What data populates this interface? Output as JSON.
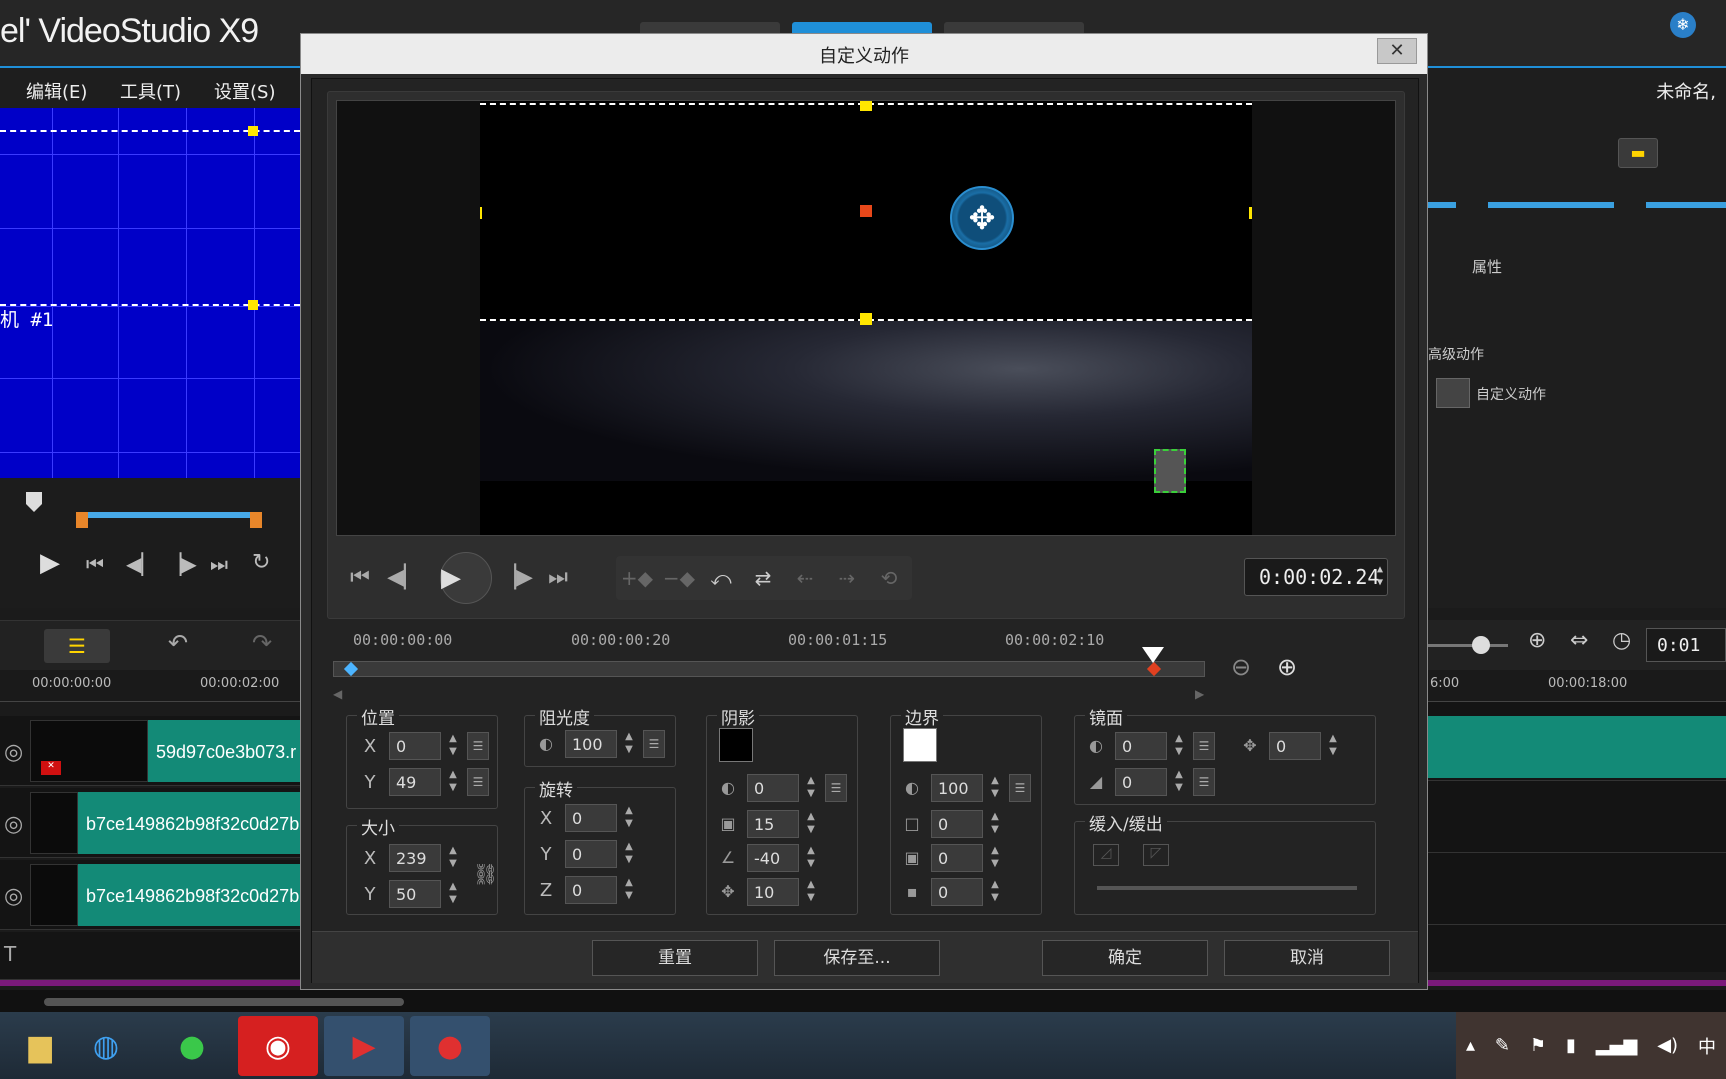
{
  "app": {
    "brand": "el' VideoStudio X9",
    "menu": [
      "编辑(E)",
      "工具(T)",
      "设置(S)"
    ],
    "project_name": "未命名, ",
    "track_label": "机 #1",
    "ruler_left": [
      "00:00:00:00",
      "00:00:02:00"
    ],
    "ruler_right": [
      "6:00",
      "00:00:18:00"
    ],
    "right_timecode": "0:01",
    "right_panel": {
      "section": "属性",
      "advanced": "高级动作",
      "custom": "自定义动作"
    },
    "clips": [
      {
        "label": "59d97c0e3b073.r"
      },
      {
        "label": "b7ce149862b98f32c0d27b"
      },
      {
        "label": "b7ce149862b98f32c0d27b"
      }
    ]
  },
  "dialog": {
    "title": "自定义动作",
    "close_label": "✕",
    "timecode": "0:00:02.24",
    "timeline_labels": [
      "00:00:00:00",
      "00:00:00:20",
      "00:00:01:15",
      "00:00:02:10"
    ],
    "playhead_fraction": 0.943,
    "groups": {
      "position": {
        "title": "位置",
        "x": "0",
        "y": "49"
      },
      "size": {
        "title": "大小",
        "x": "239",
        "y": "50"
      },
      "opacity": {
        "title": "阻光度",
        "value": "100"
      },
      "rotation": {
        "title": "旋转",
        "x": "0",
        "y": "0",
        "z": "0"
      },
      "shadow": {
        "title": "阴影",
        "color": "#000000",
        "opacity": "0",
        "blur": "15",
        "angle": "-40",
        "distance": "10"
      },
      "border": {
        "title": "边界",
        "color": "#ffffff",
        "opacity": "100",
        "width": "0",
        "blur": "0",
        "inner": "0"
      },
      "mirror": {
        "title": "镜面",
        "opacity": "0",
        "distance": "0",
        "fade": "0"
      },
      "ease": {
        "title": "缓入/缓出"
      }
    },
    "axis": {
      "x": "X",
      "y": "Y",
      "z": "Z"
    },
    "footer": {
      "reset": "重置",
      "save_to": "保存至...",
      "ok": "确定",
      "cancel": "取消"
    }
  },
  "taskbar": {
    "ime": "中"
  }
}
